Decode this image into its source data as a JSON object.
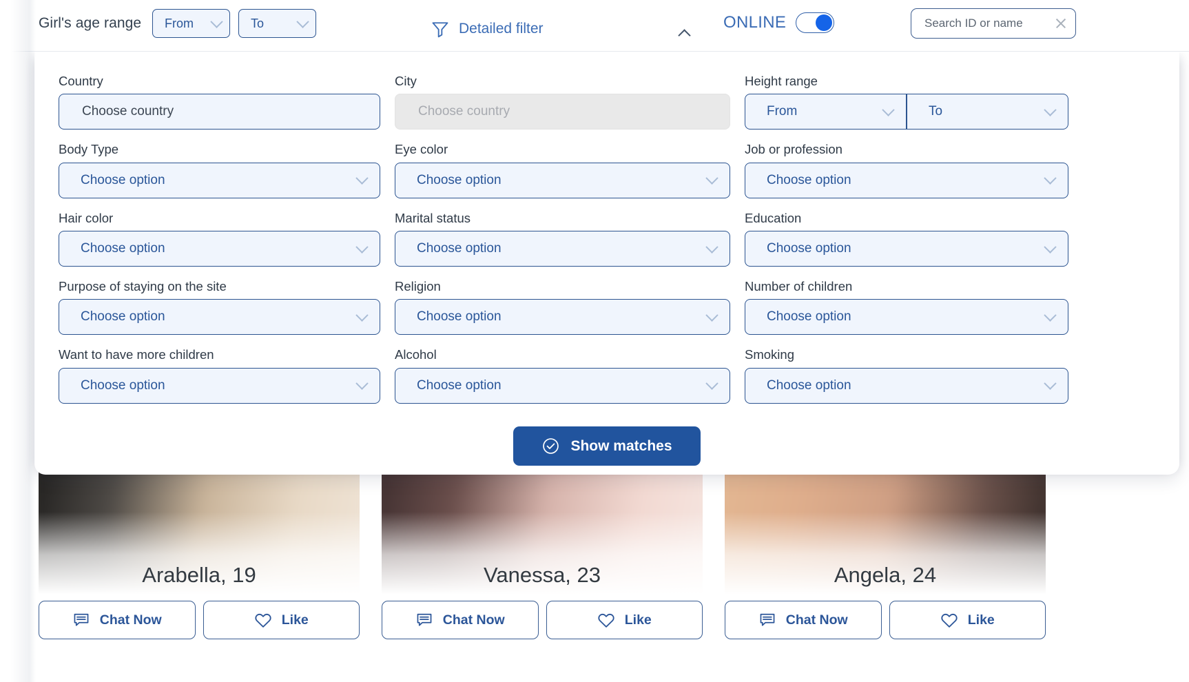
{
  "topbar": {
    "age_range_label": "Girl's age range",
    "age_from": "From",
    "age_to": "To",
    "detailed_filter": "Detailed filter",
    "online_label": "ONLINE",
    "search_placeholder": "Search ID or name",
    "search_value": ""
  },
  "filter": {
    "fields": [
      {
        "label": "Country",
        "value": "Choose country",
        "type": "text",
        "disabled": false
      },
      {
        "label": "City",
        "value": "Choose country",
        "type": "text",
        "disabled": true
      },
      {
        "label": "Height range",
        "from": "From",
        "to": "To",
        "type": "range",
        "disabled": false
      },
      {
        "label": "Body Type",
        "value": "Choose option",
        "type": "select",
        "disabled": false
      },
      {
        "label": "Eye color",
        "value": "Choose option",
        "type": "select",
        "disabled": false
      },
      {
        "label": "Job or profession",
        "value": "Choose option",
        "type": "select",
        "disabled": false
      },
      {
        "label": "Hair color",
        "value": "Choose option",
        "type": "select",
        "disabled": false
      },
      {
        "label": "Marital status",
        "value": "Choose option",
        "type": "select",
        "disabled": false
      },
      {
        "label": "Education",
        "value": "Choose option",
        "type": "select",
        "disabled": false
      },
      {
        "label": "Purpose of staying on the site",
        "value": "Choose option",
        "type": "select",
        "disabled": false
      },
      {
        "label": "Religion",
        "value": "Choose option",
        "type": "select",
        "disabled": false
      },
      {
        "label": "Number of children",
        "value": "Choose option",
        "type": "select",
        "disabled": false
      },
      {
        "label": "Want to have more children",
        "value": "Choose option",
        "type": "select",
        "disabled": false
      },
      {
        "label": "Alcohol",
        "value": "Choose option",
        "type": "select",
        "disabled": false
      },
      {
        "label": "Smoking",
        "value": "Choose option",
        "type": "select",
        "disabled": false
      }
    ],
    "show_matches_label": "Show matches"
  },
  "cards": [
    {
      "name": "Arabella, 19",
      "chat_label": "Chat Now",
      "like_label": "Like",
      "photo": [
        "#1c1b1a",
        "#4e4a46",
        "#c9b49a",
        "#e8d9c6",
        "#f0e5d8"
      ]
    },
    {
      "name": "Vanessa, 23",
      "chat_label": "Chat Now",
      "like_label": "Like",
      "photo": [
        "#3a2b2c",
        "#6b4f4c",
        "#d6b3ab",
        "#f2d9d2",
        "#f6e7e2"
      ]
    },
    {
      "name": "Angela, 24",
      "chat_label": "Chat Now",
      "like_label": "Like",
      "photo": [
        "#e3b893",
        "#dfae8c",
        "#cf9f84",
        "#6a514a",
        "#2b2321"
      ]
    }
  ],
  "colors": {
    "accent_blue": "#2a5699",
    "button_blue": "#21549e",
    "field_bg": "#f0f5fd",
    "disabled_bg": "#e9e9e9",
    "toggle_on": "#1564e8"
  }
}
